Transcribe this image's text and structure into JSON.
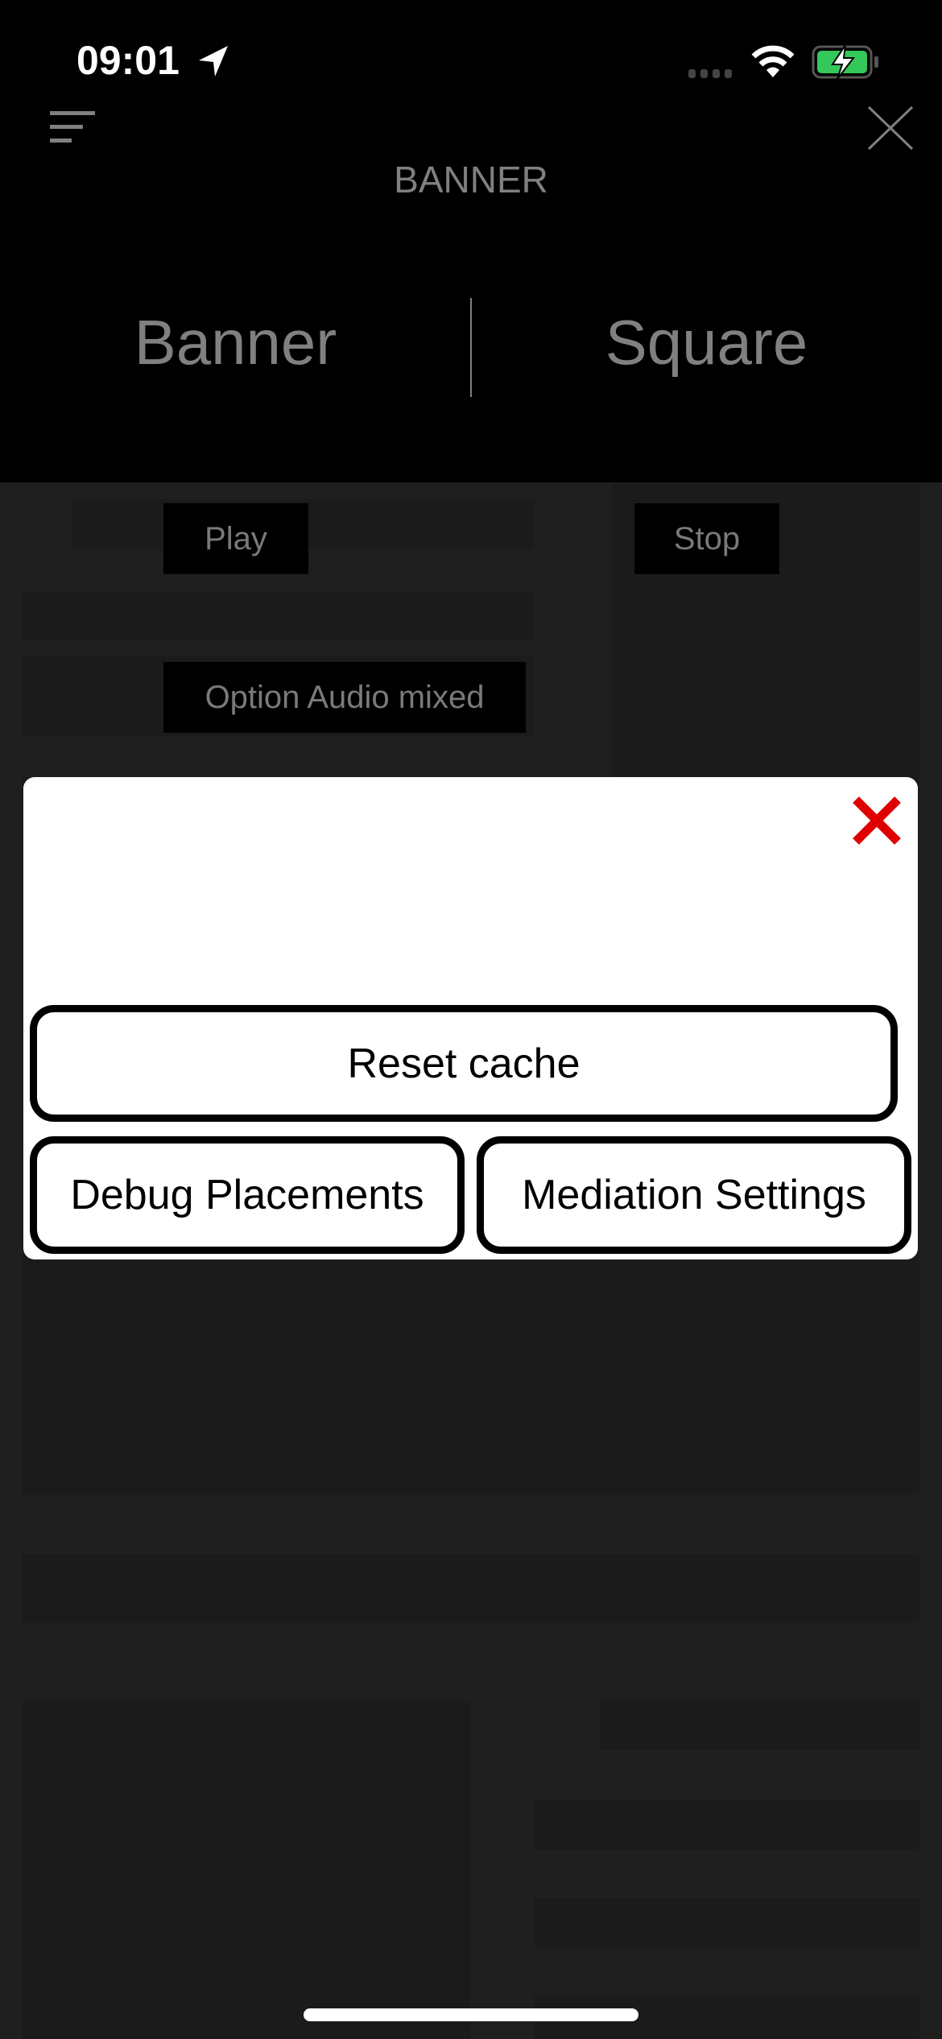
{
  "status_bar": {
    "time": "09:01",
    "icons": [
      "location-arrow-icon",
      "cellular-signal-icon",
      "wifi-icon",
      "battery-charging-icon"
    ],
    "battery_color": "#34c759"
  },
  "header": {
    "title": "BANNER",
    "menu_icon": "hamburger-menu-icon",
    "close_icon": "close-icon"
  },
  "tabs": [
    {
      "label": "Banner"
    },
    {
      "label": "Square"
    }
  ],
  "controls": {
    "play": "Play",
    "stop": "Stop",
    "audio_option": "Option Audio mixed"
  },
  "modal": {
    "close_icon_color": "#e00000",
    "reset_cache": "Reset cache",
    "debug_placements": "Debug Placements",
    "mediation_settings": "Mediation Settings"
  }
}
